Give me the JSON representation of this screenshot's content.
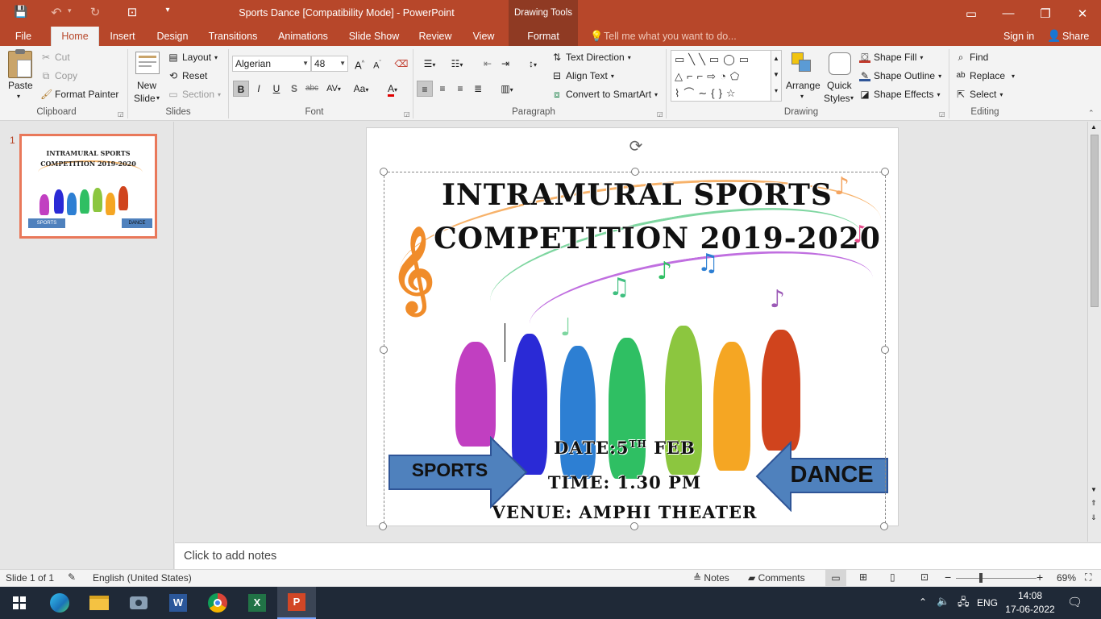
{
  "window": {
    "title": "Sports  Dance [Compatibility Mode] - PowerPoint",
    "context_tab_header": "Drawing Tools",
    "controls": {
      "restore_ribbon": "▭",
      "minimize": "—",
      "maximize": "❐",
      "close": "✕"
    }
  },
  "qat": {
    "save": "💾",
    "undo": "↶",
    "redo": "↻",
    "present": "⊡",
    "more": "▾"
  },
  "tabs": [
    {
      "label": "File"
    },
    {
      "label": "Home"
    },
    {
      "label": "Insert"
    },
    {
      "label": "Design"
    },
    {
      "label": "Transitions"
    },
    {
      "label": "Animations"
    },
    {
      "label": "Slide Show"
    },
    {
      "label": "Review"
    },
    {
      "label": "View"
    },
    {
      "label": "Format"
    }
  ],
  "tellme": "Tell me what you want to do...",
  "signin": "Sign in",
  "share": "Share",
  "ribbon": {
    "clipboard": {
      "label": "Clipboard",
      "paste": "Paste",
      "cut": "Cut",
      "copy": "Copy",
      "format_painter": "Format Painter"
    },
    "slides": {
      "label": "Slides",
      "new_slide_1": "New",
      "new_slide_2": "Slide",
      "layout": "Layout",
      "reset": "Reset",
      "section": "Section"
    },
    "font": {
      "label": "Font",
      "font_name": "Algerian",
      "font_size": "48",
      "bold": "B",
      "italic": "I",
      "underline": "U",
      "shadow": "S",
      "strike": "abc",
      "spacing": "AV",
      "case": "Aa",
      "color": "A",
      "grow": "A",
      "shrink": "A"
    },
    "paragraph": {
      "label": "Paragraph",
      "text_direction": "Text Direction",
      "align_text": "Align Text",
      "convert_smartart": "Convert to SmartArt"
    },
    "drawing": {
      "label": "Drawing",
      "arrange": "Arrange",
      "quick_styles_1": "Quick",
      "quick_styles_2": "Styles",
      "shape_fill": "Shape Fill",
      "shape_outline": "Shape Outline",
      "shape_effects": "Shape Effects"
    },
    "editing": {
      "label": "Editing",
      "find": "Find",
      "replace": "Replace",
      "select": "Select"
    }
  },
  "thumbnail": {
    "number": "1",
    "title_line1": "INTRAMURAL SPORTS",
    "title_line2": "COMPETITION  2019-2020",
    "sports": "SPORTS",
    "dance": "DANCE"
  },
  "slide": {
    "title_line1": "INTRAMURAL SPORTS",
    "title_line2": "COMPETITION  2019-2020",
    "date_prefix": "DATE:5",
    "date_sup": "TH",
    "date_suffix": " FEB",
    "time": "TIME: 1.30 PM",
    "venue": "VENUE: AMPHI THEATER",
    "sports_arrow": "SPORTS",
    "dance_arrow": "DANCE"
  },
  "notes_placeholder": "Click to add notes",
  "status": {
    "slide_count": "Slide 1 of 1",
    "language": "English (United States)",
    "notes": "Notes",
    "comments": "Comments",
    "zoom": "69%"
  },
  "taskbar": {
    "lang": "ENG",
    "time": "14:08",
    "date": "17-06-2022"
  },
  "colors": {
    "accent": "#b7472a",
    "arrow_fill": "#4f81bd",
    "taskbar": "#1f2937"
  }
}
